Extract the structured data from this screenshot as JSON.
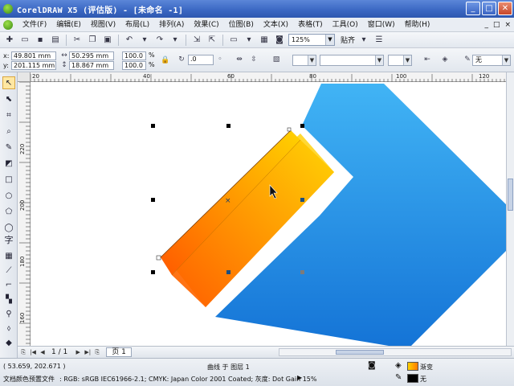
{
  "window": {
    "title": "CorelDRAW X5 (评估版) - [未命名 -1]",
    "min_label": "_",
    "max_label": "□",
    "close_label": "✕"
  },
  "menu": {
    "items": [
      "文件(F)",
      "编辑(E)",
      "视图(V)",
      "布局(L)",
      "排列(A)",
      "效果(C)",
      "位图(B)",
      "文本(X)",
      "表格(T)",
      "工具(O)",
      "窗口(W)",
      "帮助(H)"
    ],
    "right_controls": [
      "_",
      "□",
      "×"
    ]
  },
  "toolbar": {
    "zoom_value": "125%",
    "snap_label": "贴齐"
  },
  "properties": {
    "x_label": "x:",
    "x_value": "49.801 mm",
    "y_label": "y:",
    "y_value": "201.115 mm",
    "width_value": "50.295 mm",
    "height_value": "18.867 mm",
    "scale_x": "100.0",
    "scale_y": "100.0",
    "percent": "%",
    "rotation": ".0",
    "outline_label": "无"
  },
  "ruler": {
    "top_ticks": [
      "20",
      "40",
      "60",
      "80",
      "100",
      "120"
    ],
    "left_ticks": [
      "220",
      "200",
      "180",
      "160"
    ]
  },
  "pages": {
    "count": "1 / 1",
    "tab": "页 1"
  },
  "status": {
    "coords": "( 53.659, 202.671 )",
    "object_info": "曲线 于 图层 1",
    "color_profile_label": "文档颜色预置文件",
    "color_profile": ": RGB: sRGB IEC61966-2.1; CMYK: Japan Color 2001 Coated; 灰度: Dot Gain 15%",
    "fill_label": "渐变",
    "outline_label": "无"
  },
  "colors": {
    "blue_top": "#41b4f5",
    "blue_bottom": "#1473d6",
    "orange_top": "#ffd200",
    "orange_bottom": "#ff5a00",
    "title_bar": "#3c69c4"
  }
}
